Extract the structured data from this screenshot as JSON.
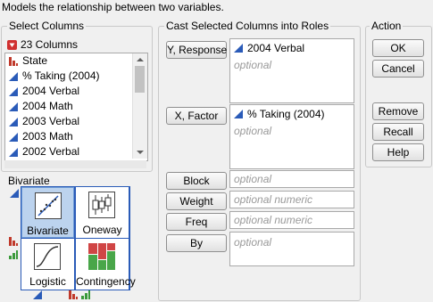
{
  "description": "Models the relationship between two variables.",
  "select_columns": {
    "legend": "Select Columns",
    "count_label": "23 Columns",
    "items": [
      {
        "label": "State",
        "icon": "nominal-icon"
      },
      {
        "label": "% Taking (2004)",
        "icon": "continuous-icon"
      },
      {
        "label": "2004 Verbal",
        "icon": "continuous-icon"
      },
      {
        "label": "2004 Math",
        "icon": "continuous-icon"
      },
      {
        "label": "2003 Verbal",
        "icon": "continuous-icon"
      },
      {
        "label": "2003 Math",
        "icon": "continuous-icon"
      },
      {
        "label": "2002 Verbal",
        "icon": "continuous-icon"
      }
    ]
  },
  "roles": {
    "legend": "Cast Selected Columns into Roles",
    "y_response": {
      "button": "Y, Response",
      "value": "2004 Verbal",
      "placeholder": "optional"
    },
    "x_factor": {
      "button": "X, Factor",
      "value": "% Taking (2004)",
      "placeholder": "optional"
    },
    "block": {
      "button": "Block",
      "placeholder": "optional"
    },
    "weight": {
      "button": "Weight",
      "placeholder": "optional numeric"
    },
    "freq": {
      "button": "Freq",
      "placeholder": "optional numeric"
    },
    "by": {
      "button": "By",
      "placeholder": "optional"
    }
  },
  "action": {
    "legend": "Action",
    "ok": "OK",
    "cancel": "Cancel",
    "remove": "Remove",
    "recall": "Recall",
    "help": "Help"
  },
  "bivariate": {
    "title": "Bivariate",
    "cells": [
      {
        "label": "Bivariate",
        "icon": "scatterplot-icon",
        "selected": true
      },
      {
        "label": "Oneway",
        "icon": "boxplot-icon",
        "selected": false
      },
      {
        "label": "Logistic",
        "icon": "logistic-curve-icon",
        "selected": false
      },
      {
        "label": "Contingency",
        "icon": "mosaic-plot-icon",
        "selected": false
      }
    ]
  },
  "colors": {
    "accent_blue": "#2a5bb8",
    "nominal_red": "#c0392b",
    "ordinal_green": "#3a9a3a",
    "selected_cell": "#bcd3ee"
  }
}
